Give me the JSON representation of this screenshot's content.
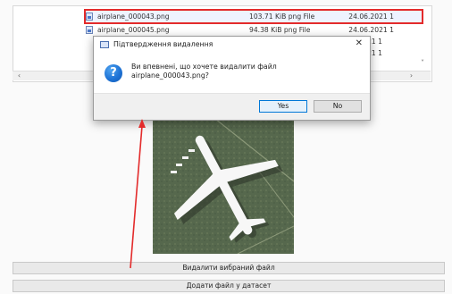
{
  "files": [
    {
      "name": "airplane_000043.png",
      "size": "103.71 KiB",
      "type": "png File",
      "date": "24.06.2021 1",
      "selected": true
    },
    {
      "name": "airplane_000045.png",
      "size": "94.38 KiB",
      "type": "png File",
      "date": "24.06.2021 1",
      "selected": false
    },
    {
      "name": "",
      "size": "",
      "type": "",
      "date": "24.06.2021 1",
      "selected": false
    },
    {
      "name": "",
      "size": "",
      "type": "",
      "date": "24.06.2021 1",
      "selected": false
    }
  ],
  "dialog": {
    "title": "Підтвердження видалення",
    "message": "Ви впевнені, що хочете видалити файл airplane_000043.png?",
    "yes_label": "Yes",
    "no_label": "No",
    "icon": "question-icon"
  },
  "buttons": {
    "delete_label": "Видалити вибраний файл",
    "add_label": "Додати файл у датасет"
  },
  "colors": {
    "highlight": "#e32b2b",
    "accent": "#1e73d6"
  }
}
